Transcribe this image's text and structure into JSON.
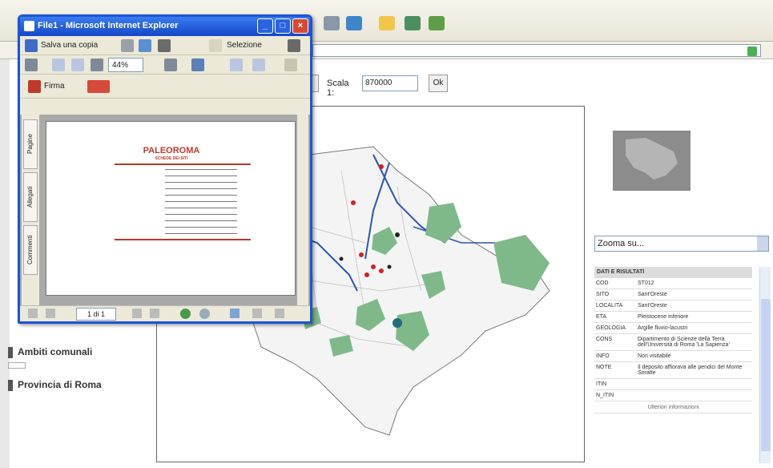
{
  "scale": {
    "label": "Scala 1:",
    "value": "870000",
    "ok_label": "Ok"
  },
  "zoom": {
    "value": "Zooma su..."
  },
  "legend": [
    {
      "label": "Ambiti comunali"
    },
    {
      "label": "Provincia di Roma"
    }
  ],
  "info": {
    "header": "DATI E RISULTATI",
    "rows": [
      {
        "key": "COD",
        "value": "ST012"
      },
      {
        "key": "SITO",
        "value": "Sant'Oreste"
      },
      {
        "key": "LOCALITA",
        "value": "Sant'Oreste"
      },
      {
        "key": "ETA",
        "value": "Pleistocene inferiore"
      },
      {
        "key": "GEOLOGIA",
        "value": "Argille fluvio-lacustri"
      },
      {
        "key": "CONS",
        "value": "Dipartimento di Scienze della Terra dell'Università di Roma 'La Sapienza'"
      },
      {
        "key": "INFO",
        "value": "Non visitabile"
      },
      {
        "key": "NOTE",
        "value": "Il deposito affiorava alle pendici del Monte Soratte"
      },
      {
        "key": "ITIN",
        "value": ""
      },
      {
        "key": "N_ITIN",
        "value": ""
      }
    ],
    "more": "Ulteriori informazioni"
  },
  "popup": {
    "title": "File1 - Microsoft Internet Explorer",
    "save_copy": "Salva una copia",
    "select": "Selezione",
    "zoom_value": "44%",
    "sign": "Firma",
    "page_indicator": "1 di 1",
    "tabs": [
      "Pagine",
      "Allegati",
      "Commenti"
    ],
    "doc_title": "PALEOROMA",
    "doc_subtitle": "SCHEDE DEI SITI"
  },
  "colors": {
    "popup_border": "#1c54d6",
    "map_green": "#7fb98a",
    "river_blue": "#2c55b8",
    "site_red": "#d62020"
  }
}
